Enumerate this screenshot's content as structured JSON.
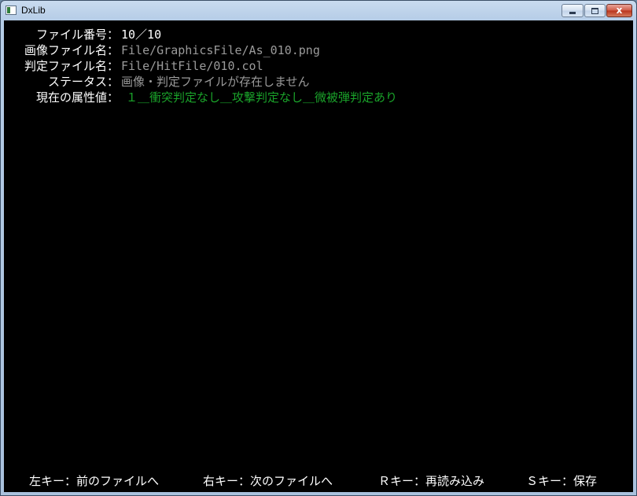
{
  "window": {
    "title": "DxLib",
    "close_glyph": "x",
    "colors": {
      "client_bg": "#000000",
      "label": "#ffffff",
      "value": "#9b9b9b",
      "attribute": "#1aa32a"
    }
  },
  "info": {
    "file_number_label": "ファイル番号：",
    "file_number_value": "10／10",
    "image_file_label": "画像ファイル名：",
    "image_file_value": "File/GraphicsFile/As_010.png",
    "hit_file_label": "判定ファイル名：",
    "hit_file_value": "File/HitFile/010.col",
    "status_label": "ステータス：",
    "status_value": "画像・判定ファイルが存在しません",
    "attribute_label": "現在の属性値：",
    "attribute_value": "１＿衝突判定なし＿攻撃判定なし＿微被弾判定あり"
  },
  "footer": {
    "left_key": "左キー：前のファイルへ",
    "right_key": "右キー：次のファイルへ",
    "r_key": "Ｒキー：再読み込み",
    "s_key": "Ｓキー：保存"
  }
}
